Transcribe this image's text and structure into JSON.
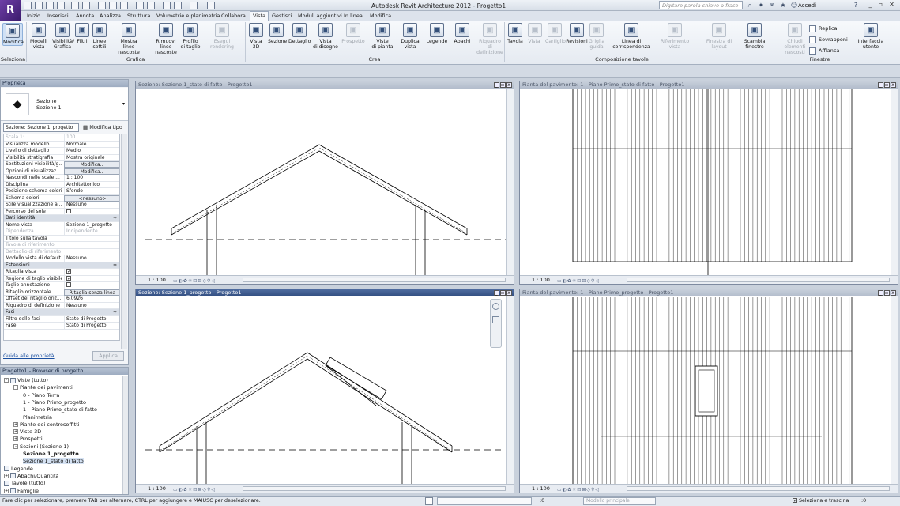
{
  "app": {
    "logo": "R",
    "title": "Autodesk Revit Architecture 2012 -    Progetto1",
    "search_placeholder": "Digitare parola chiave o frase",
    "signin": "Accedi"
  },
  "tabs": [
    "Inizio",
    "Inserisci",
    "Annota",
    "Analizza",
    "Struttura",
    "Volumetrie e planimetria",
    "Collabora",
    "Vista",
    "Gestisci",
    "Moduli aggiuntivi",
    "In linea",
    "Modifica"
  ],
  "active_tab": "Vista",
  "ribbon": {
    "buttons": [
      {
        "label": "Modifica",
        "icon": "cursor-icon",
        "selected": true
      },
      {
        "label": "Modelli\nvista",
        "icon": "view-templates-icon"
      },
      {
        "label": "Visibilità/\nGrafica",
        "icon": "visibility-icon"
      },
      {
        "label": "Filtri",
        "icon": "filters-icon"
      },
      {
        "label": "Linee\nsottili",
        "icon": "thin-lines-icon"
      },
      {
        "label": "Mostra\nlinee nascoste",
        "icon": "show-hidden-icon"
      },
      {
        "label": "Rimuovi\nlinee nascoste",
        "icon": "remove-hidden-icon"
      },
      {
        "label": "Profilo\ndi taglio",
        "icon": "cut-profile-icon"
      },
      {
        "label": "Esegui rendering",
        "icon": "render-icon",
        "disabled": true
      },
      {
        "label": "Vista\n3D",
        "icon": "3d-view-icon"
      },
      {
        "label": "Sezione",
        "icon": "section-icon"
      },
      {
        "label": "Dettaglio",
        "icon": "callout-icon"
      },
      {
        "label": "Vista\ndi disegno",
        "icon": "drafting-view-icon"
      },
      {
        "label": "Prospetto",
        "icon": "elevation-icon",
        "disabled": true
      },
      {
        "label": "Viste\ndi pianta",
        "icon": "plan-views-icon"
      },
      {
        "label": "Duplica\nvista",
        "icon": "duplicate-view-icon"
      },
      {
        "label": "Legende",
        "icon": "legends-icon"
      },
      {
        "label": "Abachi",
        "icon": "schedules-icon"
      },
      {
        "label": "Riquadro\ndi definizione",
        "icon": "scope-box-icon",
        "disabled": true
      },
      {
        "label": "Tavola",
        "icon": "sheet-icon"
      },
      {
        "label": "Vista",
        "icon": "view-icon",
        "disabled": true
      },
      {
        "label": "Cartiglio",
        "icon": "title-block-icon",
        "disabled": true
      },
      {
        "label": "Revisioni",
        "icon": "revisions-icon"
      },
      {
        "label": "Griglia\nguida",
        "icon": "guide-grid-icon",
        "disabled": true
      },
      {
        "label": "Linea di corrispondenza",
        "icon": "matchline-icon"
      },
      {
        "label": "Riferimento\nvista",
        "icon": "view-reference-icon",
        "disabled": true
      },
      {
        "label": "Finestra di layout",
        "icon": "viewports-icon",
        "disabled": true
      },
      {
        "label": "Scambia\nfinestre",
        "icon": "switch-windows-icon"
      },
      {
        "label": "Chiudi\nelementi nascosti",
        "icon": "close-hidden-icon",
        "disabled": true
      },
      {
        "label": "Interfaccia\nutente",
        "icon": "user-interface-icon"
      }
    ],
    "small_buttons": [
      {
        "label": "Replica",
        "icon": "replicate-icon"
      },
      {
        "label": "Sovrapponi",
        "icon": "cascade-icon"
      },
      {
        "label": "Affianca",
        "icon": "tile-icon"
      }
    ],
    "panels": [
      "Seleziona",
      "Grafica",
      "Crea",
      "Composizione tavole",
      "Finestre"
    ]
  },
  "properties": {
    "title": "Proprietà",
    "type_line1": "Sezione",
    "type_line2": "Sezione 1",
    "view_selector": "Sezione: Sezione 1_progetto",
    "edit_type": "Modifica tipo",
    "rows": [
      {
        "k": "Scala 1:",
        "v": "100",
        "dis": true
      },
      {
        "k": "Visualizza modello",
        "v": "Normale"
      },
      {
        "k": "Livello di dettaglio",
        "v": "Medio"
      },
      {
        "k": "Visibilità stratigrafia",
        "v": "Mostra originale"
      },
      {
        "k": "Sostituzioni visibilità/g...",
        "v": "Modifica...",
        "button": true
      },
      {
        "k": "Opzioni di visualizzaz...",
        "v": "Modifica...",
        "button": true
      },
      {
        "k": "Nascondi nelle scale ...",
        "v": "1 : 100"
      },
      {
        "k": "Disciplina",
        "v": "Architettonico"
      },
      {
        "k": "Posizione schema colori",
        "v": "Sfondo"
      },
      {
        "k": "Schema colori",
        "v": "<nessuno>",
        "button": true
      },
      {
        "k": "Stile visualizzazione a...",
        "v": "Nessuno"
      },
      {
        "k": "Percorso del sole",
        "v": "",
        "check": false
      },
      {
        "k": "Dati identità",
        "v": "",
        "group": true
      },
      {
        "k": "Nome vista",
        "v": "Sezione 1_progetto"
      },
      {
        "k": "Dipendenza",
        "v": "Indipendente",
        "dis": true
      },
      {
        "k": "Titolo sulla tavola",
        "v": ""
      },
      {
        "k": "Tavola di riferimento",
        "v": "",
        "dis": true
      },
      {
        "k": "Dettaglio di riferimento",
        "v": "",
        "dis": true
      },
      {
        "k": "Modello vista di default",
        "v": "Nessuno"
      },
      {
        "k": "Estensioni",
        "v": "",
        "group": true
      },
      {
        "k": "Ritaglia vista",
        "v": "",
        "check": true
      },
      {
        "k": "Regione di taglio visibile",
        "v": "",
        "check": true
      },
      {
        "k": "Taglio annotazione",
        "v": "",
        "check": false
      },
      {
        "k": "Ritaglio orizzontale",
        "v": "Ritaglia senza linea",
        "button": true
      },
      {
        "k": "Offset del ritaglio oriz...",
        "v": "6.0926"
      },
      {
        "k": "Riquadro di definizione",
        "v": "Nessuno"
      },
      {
        "k": "Fasi",
        "v": "",
        "group": true
      },
      {
        "k": "Filtro delle fasi",
        "v": "Stato di Progetto"
      },
      {
        "k": "Fase",
        "v": "Stato di Progetto"
      }
    ],
    "help_link": "Guida alle proprietà",
    "apply": "Applica"
  },
  "browser": {
    "title": "Progetto1 - Browser di progetto",
    "nodes": [
      {
        "label": "Viste (tutto)",
        "level": 0,
        "tog": "-",
        "icon": true
      },
      {
        "label": "Piante dei pavimenti",
        "level": 1,
        "tog": "-"
      },
      {
        "label": "0 - Piano Terra",
        "level": 2
      },
      {
        "label": "1 - Piano Primo_progetto",
        "level": 2
      },
      {
        "label": "1 - Piano Primo_stato di fatto",
        "level": 2
      },
      {
        "label": "Planimetria",
        "level": 2
      },
      {
        "label": "Piante dei controsoffitti",
        "level": 1,
        "tog": "+"
      },
      {
        "label": "Viste 3D",
        "level": 1,
        "tog": "+"
      },
      {
        "label": "Prospetti",
        "level": 1,
        "tog": "+"
      },
      {
        "label": "Sezioni (Sezione 1)",
        "level": 1,
        "tog": "-"
      },
      {
        "label": "Sezione 1_progetto",
        "level": 2,
        "bold": true
      },
      {
        "label": "Sezione 1_stato di fatto",
        "level": 2,
        "hl": true
      },
      {
        "label": "Legende",
        "level": 0,
        "icon": true
      },
      {
        "label": "Abachi/Quantità",
        "level": 0,
        "tog": "+",
        "icon": true
      },
      {
        "label": "Tavole (tutto)",
        "level": 0,
        "icon": true
      },
      {
        "label": "Famiglie",
        "level": 0,
        "tog": "+",
        "icon": true
      }
    ]
  },
  "viewports": [
    {
      "title": "Sezione: Sezione 1_stato di fatto - Progetto1",
      "scale": "1 : 100",
      "active": false
    },
    {
      "title": "Pianta del pavimento: 1 - Piano Primo_stato di fatto - Progetto1",
      "scale": "1 : 100",
      "active": false
    },
    {
      "title": "Sezione: Sezione 1_progetto - Progetto1",
      "scale": "1 : 100",
      "active": true
    },
    {
      "title": "Pianta del pavimento: 1 - Piano Primo_progetto - Progetto1",
      "scale": "1 : 100",
      "active": false
    }
  ],
  "status": {
    "text": "Fare clic per selezionare, premere TAB per alternare, CTRL per aggiungere e MAIUSC per deselezionare.",
    "zero": ":0",
    "model": "Modello principale",
    "select_drag": "Seleziona e trascina",
    "zero2": ":0"
  }
}
